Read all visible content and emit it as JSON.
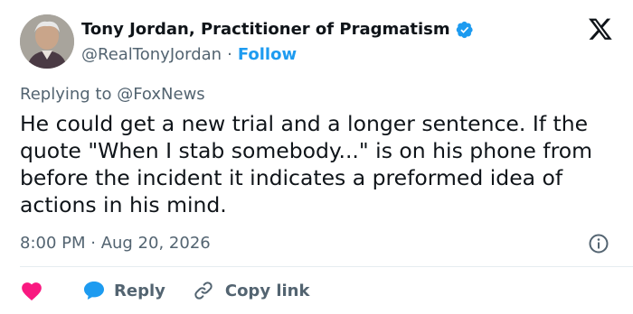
{
  "author": {
    "display_name": "Tony Jordan, Practitioner of Pragmatism",
    "handle": "@RealTonyJordan",
    "separator": "·",
    "follow_label": "Follow",
    "verified": true
  },
  "reply_context": {
    "prefix": "Replying to",
    "user": "@FoxNews"
  },
  "tweet": {
    "text": "He could get a new trial and a longer sentence. If the quote \"When I stab somebody...\" is on his phone from before the incident it indicates a preformed idea of actions in his mind.",
    "timestamp": "8:00 PM · Aug 20, 2026"
  },
  "actions": {
    "like_icon": "heart-icon",
    "reply_label": "Reply",
    "copy_link_label": "Copy link"
  },
  "colors": {
    "accent": "#1d9bf0",
    "heart": "#f91880",
    "secondary_text": "#536471",
    "primary_text": "#0f1419"
  }
}
